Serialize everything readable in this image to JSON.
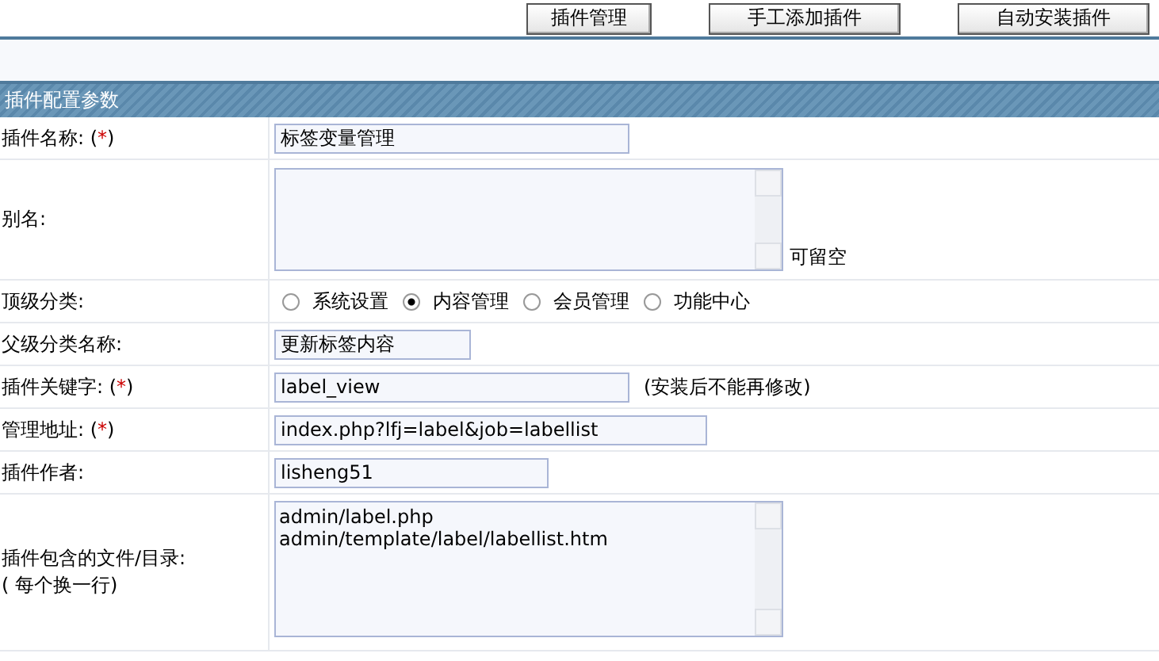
{
  "toolbar": {
    "buttons": [
      "插件管理",
      "手工添加插件",
      "自动安装插件"
    ]
  },
  "section": {
    "title": "插件配置参数"
  },
  "rows": [
    {
      "kind": "text",
      "label": "插件名称:",
      "required": {
        "open": "(",
        "star": "*",
        "close": ")"
      },
      "value": "标签变量管理"
    },
    {
      "kind": "textarea",
      "label": "别名:",
      "lines": [],
      "hint": "可留空"
    },
    {
      "kind": "radio",
      "label": "顶级分类:",
      "options": [
        {
          "label": "系统设置",
          "selected": false
        },
        {
          "label": "内容管理",
          "selected": true
        },
        {
          "label": "会员管理",
          "selected": false
        },
        {
          "label": "功能中心",
          "selected": false
        }
      ]
    },
    {
      "kind": "text",
      "label": "父级分类名称:",
      "value": "更新标签内容"
    },
    {
      "kind": "text",
      "label": "插件关键字:",
      "required": {
        "open": "(",
        "star": "*",
        "close": ")"
      },
      "value": "label_view",
      "note": "(安装后不能再修改)"
    },
    {
      "kind": "text",
      "label": "管理地址:",
      "required": {
        "open": "(",
        "star": "*",
        "close": ")"
      },
      "value": "index.php?lfj=label&job=labellist"
    },
    {
      "kind": "text",
      "label": "插件作者:",
      "value": "lisheng51"
    },
    {
      "kind": "textarea",
      "label": "插件包含的文件/目录:",
      "sublabel": "( 每个换一行)",
      "lines": [
        "admin/label.php",
        "admin/template/label/labellist.htm"
      ]
    }
  ]
}
